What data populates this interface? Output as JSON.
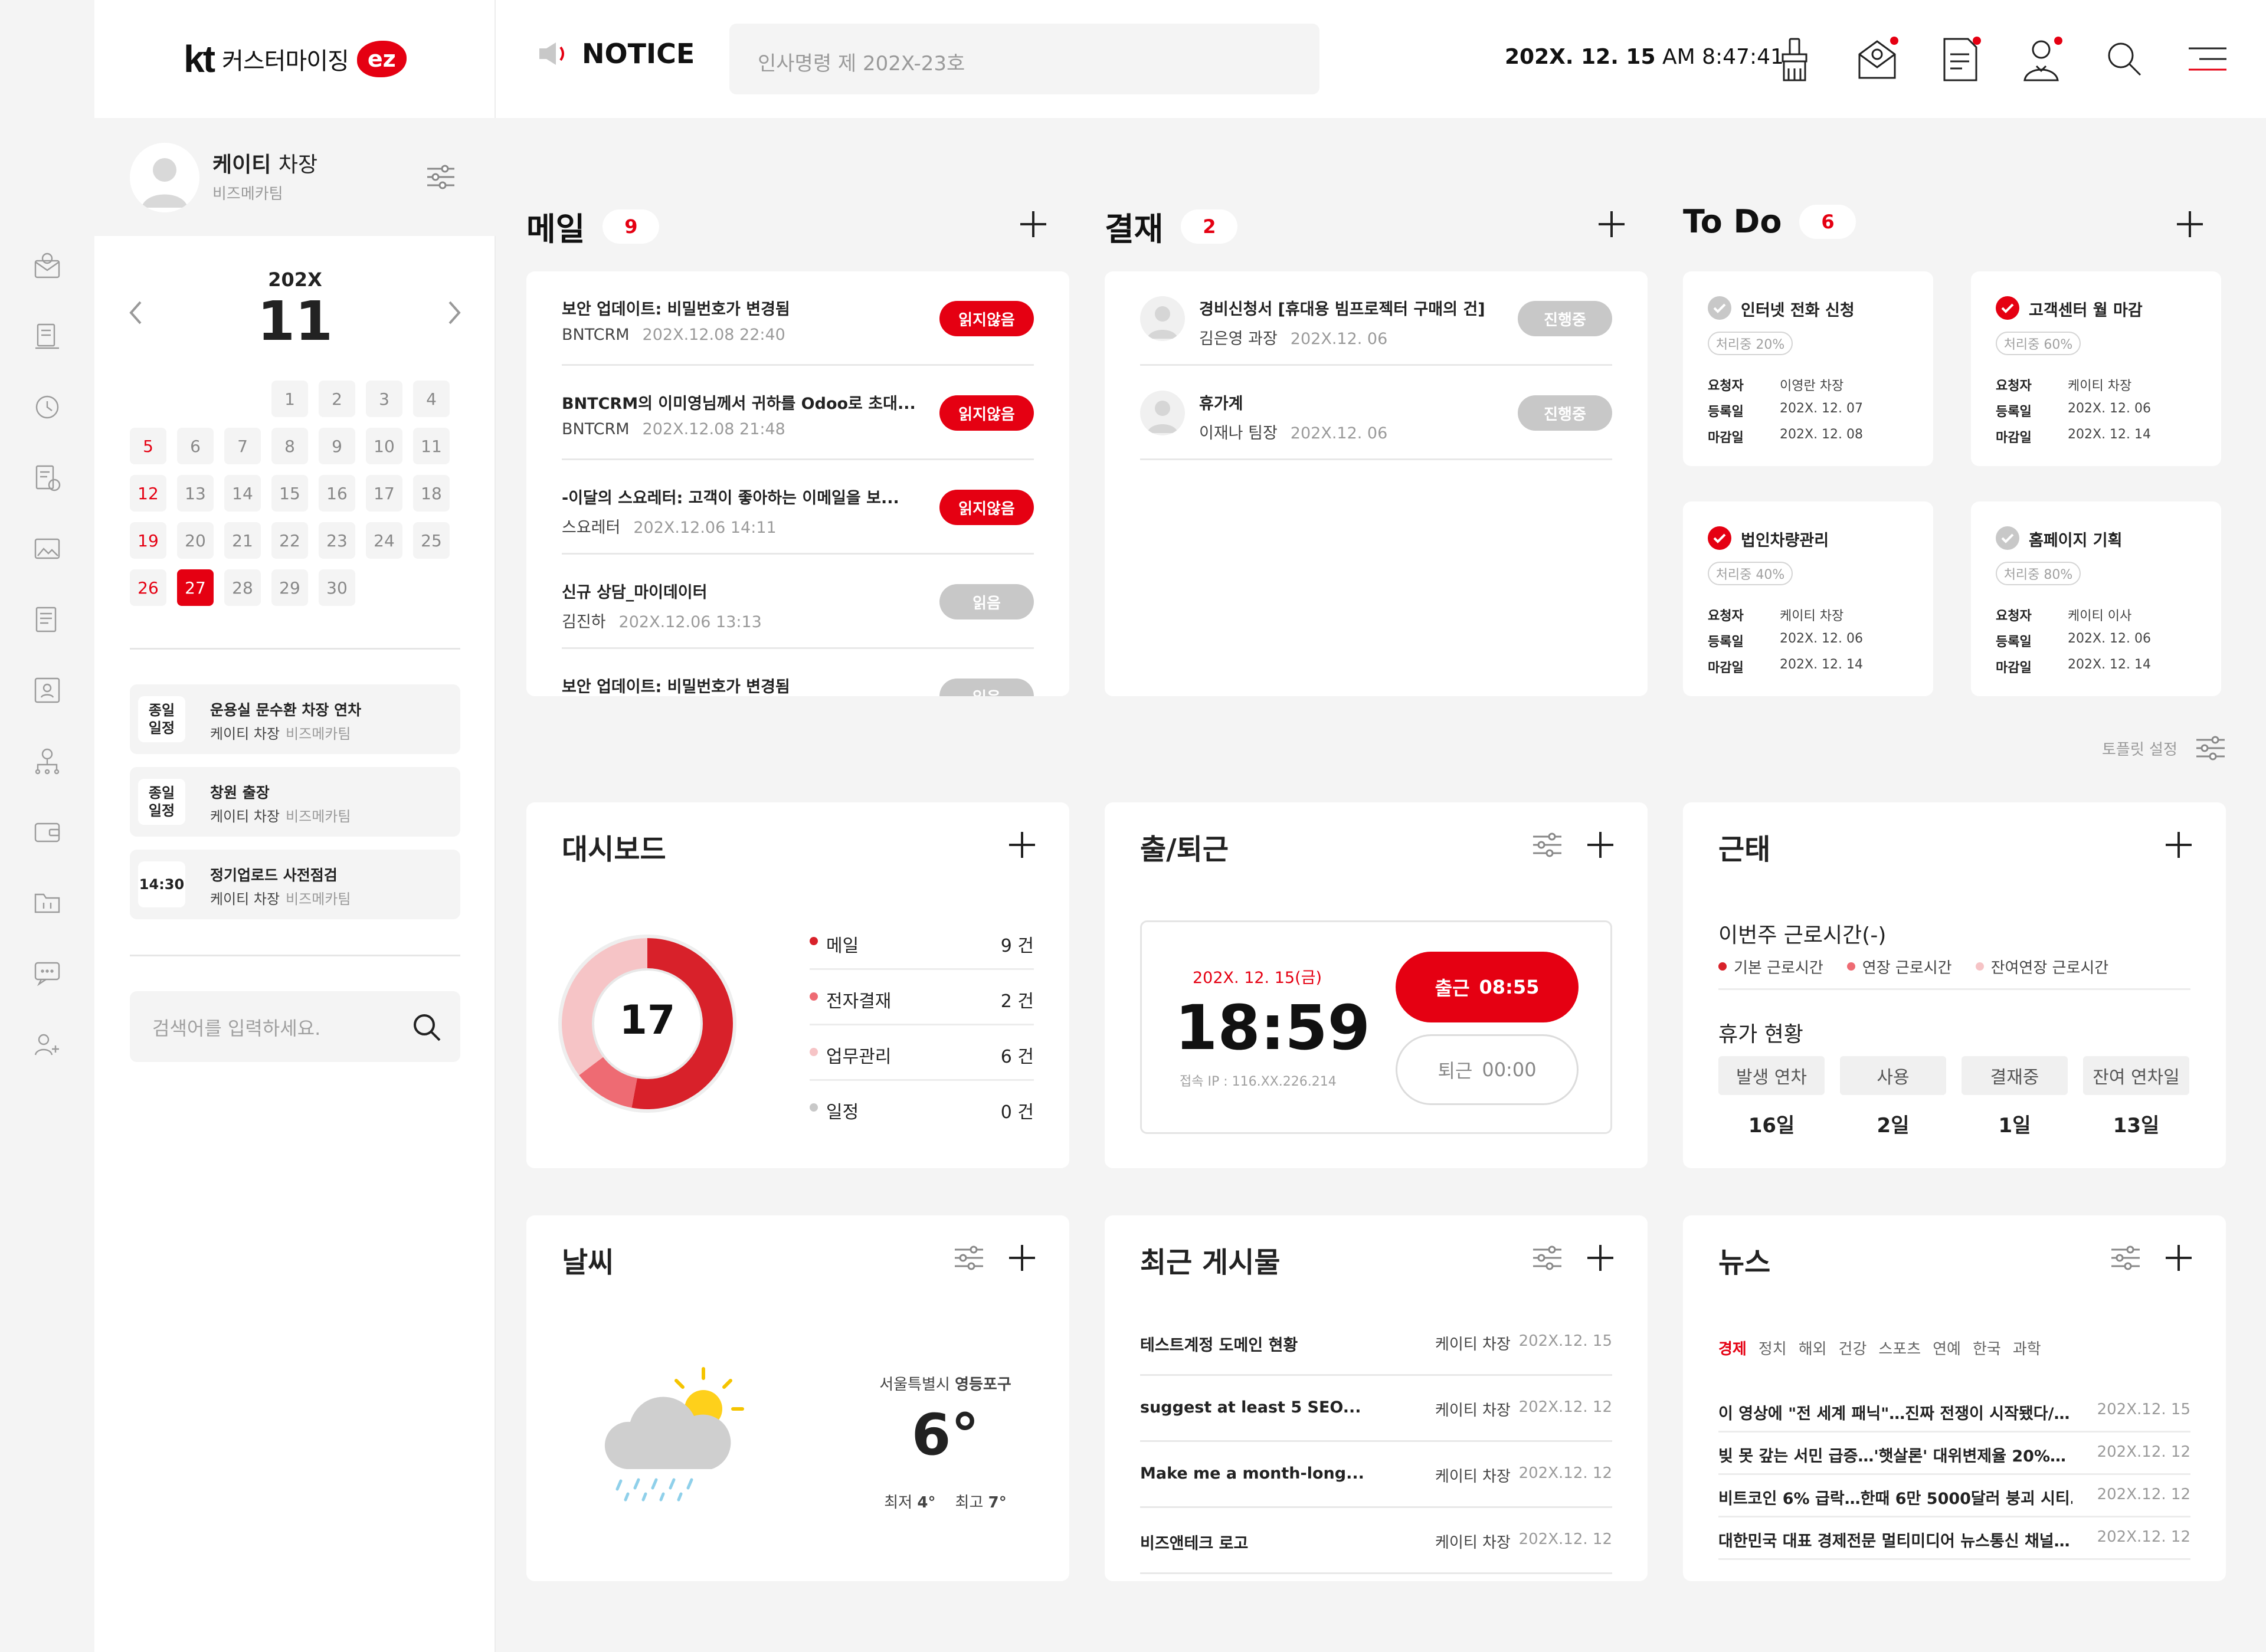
{
  "logo": {
    "kt": "kt",
    "brand": "커스터마이징",
    "ez": "ez"
  },
  "profile": {
    "name": "케이티",
    "title": "차장",
    "dept": "비즈메카팀"
  },
  "calendar": {
    "year": "202X",
    "month": "11",
    "days": [
      "1",
      "2",
      "3",
      "4",
      "5",
      "6",
      "7",
      "8",
      "9",
      "10",
      "11",
      "12",
      "13",
      "14",
      "15",
      "16",
      "17",
      "18",
      "19",
      "20",
      "21",
      "22",
      "23",
      "24",
      "25",
      "26",
      "27",
      "28",
      "29",
      "30"
    ],
    "selected": "27"
  },
  "schedules": [
    {
      "time": "종일\n일정",
      "title": "운용실 문수환 차장 연차",
      "user": "케이티 차장",
      "dept": "비즈메카팀"
    },
    {
      "time": "종일\n일정",
      "title": "창원 출장",
      "user": "케이티 차장",
      "dept": "비즈메카팀"
    },
    {
      "time": "14:30",
      "title": "정기업로드 사전점검",
      "user": "케이티 차장",
      "dept": "비즈메카팀"
    }
  ],
  "side_search": {
    "placeholder": "검색어를 입력하세요."
  },
  "header": {
    "notice_label": "NOTICE",
    "notice_text": "인사명령 제 202X-23호",
    "date": "202X. 12. 15",
    "time": "AM 8:47:41"
  },
  "mail": {
    "title": "메일",
    "count": "9",
    "items": [
      {
        "title": "보안 업데이트: 비밀번호가 변경됨",
        "from": "BNTCRM",
        "date": "202X.12.08 22:40",
        "status": "읽지않음",
        "unread": true
      },
      {
        "title": "BNTCRM의 이미영님께서 귀하를 Odoo로 초대...",
        "from": "BNTCRM",
        "date": "202X.12.08 21:48",
        "status": "읽지않음",
        "unread": true
      },
      {
        "title": "-이달의 스요레터: 고객이 좋아하는 이메일을 보...",
        "from": "스요레터",
        "date": "202X.12.06 14:11",
        "status": "읽지않음",
        "unread": true
      },
      {
        "title": "신규 상담_마이데이터",
        "from": "김진하",
        "date": "202X.12.06 13:13",
        "status": "읽음",
        "unread": false
      },
      {
        "title": "보안 업데이트: 비밀번호가 변경됨",
        "from": "",
        "date": "",
        "status": "읽음",
        "unread": false
      }
    ]
  },
  "approval": {
    "title": "결재",
    "count": "2",
    "items": [
      {
        "title": "경비신청서 [휴대용 빔프로젝터 구매의 건]",
        "user": "김은영 과장",
        "date": "202X.12. 06",
        "status": "진행중"
      },
      {
        "title": "휴가계",
        "user": "이재나 팀장",
        "date": "202X.12. 06",
        "status": "진행중"
      }
    ]
  },
  "todo": {
    "title": "To Do",
    "count": "6",
    "labels": {
      "requester": "요청자",
      "registered": "등록일",
      "due": "마감일"
    },
    "items": [
      {
        "title": "인터넷 전화 신청",
        "progress": "처리중 20%",
        "requester": "이영란 차장",
        "registered": "202X. 12. 07",
        "due": "202X. 12. 08",
        "done": false
      },
      {
        "title": "고객센터 월 마감",
        "progress": "처리중 60%",
        "requester": "케이티 차장",
        "registered": "202X. 12. 06",
        "due": "202X. 12. 14",
        "done": true
      },
      {
        "title": "법인차량관리",
        "progress": "처리중 40%",
        "requester": "케이티 차장",
        "registered": "202X. 12. 06",
        "due": "202X. 12. 14",
        "done": true
      },
      {
        "title": "홈페이지 기획",
        "progress": "처리중 80%",
        "requester": "케이티 이사",
        "registered": "202X. 12. 06",
        "due": "202X. 12. 14",
        "done": false
      }
    ]
  },
  "template_setting": "토플릿 설정",
  "dashboard": {
    "title": "대시보드",
    "total": "17",
    "items": [
      {
        "label": "메일",
        "value": 9,
        "text": "9 건",
        "color": "#d8212a"
      },
      {
        "label": "전자결재",
        "value": 2,
        "text": "2 건",
        "color": "#ee6b73"
      },
      {
        "label": "업무관리",
        "value": 6,
        "text": "6 건",
        "color": "#f6c4c6"
      },
      {
        "label": "일정",
        "value": 0,
        "text": "0 건",
        "color": "#c8c8c8"
      }
    ]
  },
  "attendance": {
    "title": "출/퇴근",
    "date": "202X. 12. 15(금)",
    "time": "18:59",
    "ip": "접속 IP : 116.XX.226.214",
    "in_label": "출근",
    "in_time": "08:55",
    "out_label": "퇴근",
    "out_time": "00:00"
  },
  "worktime": {
    "title": "근태",
    "week_label": "이번주 근로시간(-)",
    "legend": [
      {
        "label": "기본 근로시간",
        "color": "#d8212a"
      },
      {
        "label": "연장 근로시간",
        "color": "#ee6b73"
      },
      {
        "label": "잔여연장 근로시간",
        "color": "#f6c4c6"
      }
    ],
    "vacation_label": "휴가 현황",
    "vacation": [
      {
        "label": "발생 연차",
        "value": "16일"
      },
      {
        "label": "사용",
        "value": "2일"
      },
      {
        "label": "결재중",
        "value": "1일"
      },
      {
        "label": "잔여 연차일",
        "value": "13일"
      }
    ]
  },
  "weather": {
    "title": "날씨",
    "city": "서울특별시",
    "district": "영등포구",
    "temp": "6°",
    "min_label": "최저",
    "min": "4°",
    "max_label": "최고",
    "max": "7°"
  },
  "board": {
    "title": "최근 게시물",
    "items": [
      {
        "title": "테스트계정 도메인 현황",
        "author": "케이티 차장",
        "date": "202X.12. 15"
      },
      {
        "title": "suggest at least 5 SEO...",
        "author": "케이티 차장",
        "date": "202X.12. 12"
      },
      {
        "title": "Make me a month-long...",
        "author": "케이티 차장",
        "date": "202X.12. 12"
      },
      {
        "title": "비즈앤테크 로고",
        "author": "케이티 차장",
        "date": "202X.12. 12"
      }
    ]
  },
  "news": {
    "title": "뉴스",
    "tabs": [
      "경제",
      "정치",
      "해외",
      "건강",
      "스포츠",
      "연예",
      "한국",
      "과학"
    ],
    "active_tab": "경제",
    "items": [
      {
        "title": "이 영상에 \"전 세계 패닉\"…진짜 전쟁이 시작됐다/…",
        "date": "202X.12. 15"
      },
      {
        "title": "빚 못 갚는 서민 급증…'햇살론' 대위변제율 20%…",
        "date": "202X.12. 12"
      },
      {
        "title": "비트코인 6% 급락…한때 6만 5000달러 붕괴 시티…",
        "date": "202X.12. 12"
      },
      {
        "title": "대한민국 대표 경제전문 멀티미디어 뉴스통신 채널…",
        "date": "202X.12. 12"
      }
    ]
  }
}
